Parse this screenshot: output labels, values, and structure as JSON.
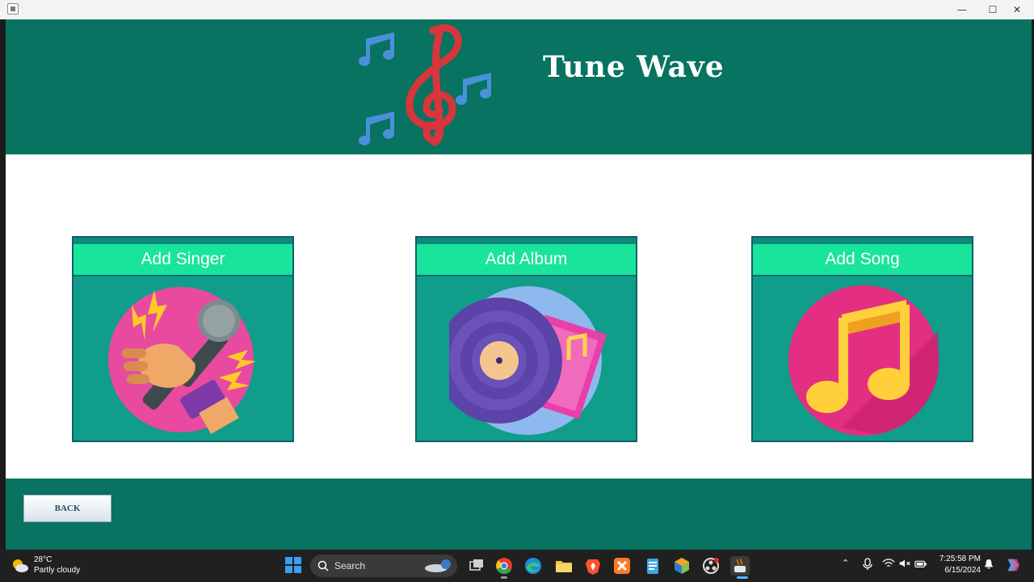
{
  "window": {
    "min_glyph": "—",
    "max_glyph": "☐",
    "close_glyph": "✕"
  },
  "header": {
    "title": "Tune Wave",
    "logo_icon": "music-clef-notes-icon"
  },
  "cards": [
    {
      "label": "Add Singer",
      "icon": "microphone-icon"
    },
    {
      "label": "Add Album",
      "icon": "vinyl-record-icon"
    },
    {
      "label": "Add Song",
      "icon": "music-note-icon"
    }
  ],
  "footer": {
    "back_label": "BACK"
  },
  "taskbar": {
    "weather": {
      "temp": "28°C",
      "desc": "Partly cloudy",
      "icon": "partly-cloudy-icon"
    },
    "search_placeholder": "Search",
    "tray": {
      "time": "7:25:58 PM",
      "date": "6/15/2024"
    }
  },
  "colors": {
    "header_bg": "#077360",
    "card_bg": "#109d8a",
    "card_header_bg": "#19e49b",
    "content_bg": "#ffffff"
  }
}
